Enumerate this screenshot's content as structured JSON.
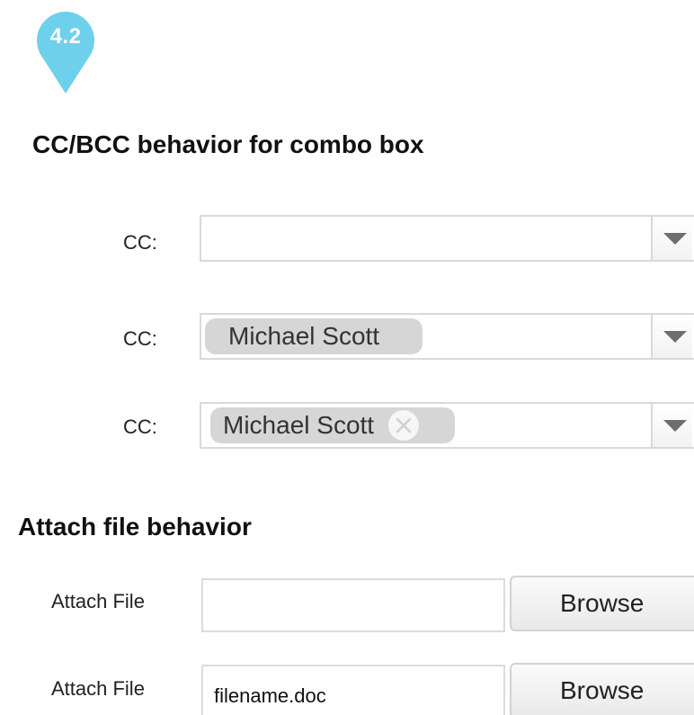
{
  "marker": {
    "label": "4.2",
    "color": "#6fd0ec"
  },
  "sections": {
    "cc": {
      "title": "CC/BCC behavior for combo box"
    },
    "attach": {
      "title": "Attach file behavior"
    }
  },
  "cc_rows": [
    {
      "label": "CC:",
      "chip": null
    },
    {
      "label": "CC:",
      "chip": "Michael Scott"
    },
    {
      "label": "CC:",
      "chip": "Michael Scott",
      "removable": true
    }
  ],
  "attach_rows": [
    {
      "label": "Attach File",
      "value": "",
      "button": "Browse"
    },
    {
      "label": "Attach File",
      "value": "filename.doc",
      "button": "Browse"
    }
  ],
  "icons": {
    "dropdown": "triangle-down-icon",
    "remove": "circle-x-icon"
  }
}
